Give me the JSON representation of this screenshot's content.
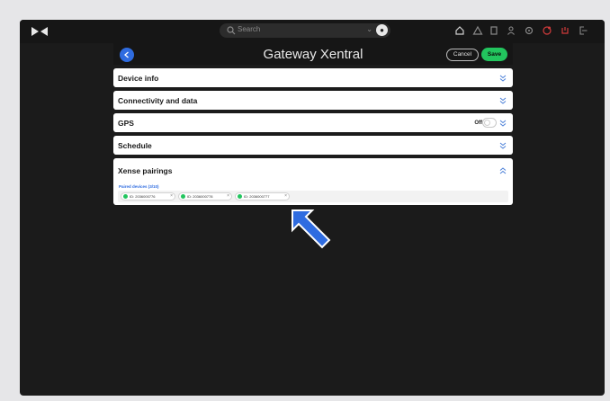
{
  "topbar": {
    "search_placeholder": "Search",
    "icons": [
      "home-icon",
      "alert-icon",
      "building-icon",
      "user-icon",
      "settings-icon",
      "notifications-icon",
      "power-icon",
      "logout-icon"
    ]
  },
  "header": {
    "title": "Gateway Xentral",
    "cancel_label": "Cancel",
    "save_label": "Save"
  },
  "sections": [
    {
      "title": "Device info"
    },
    {
      "title": "Connectivity and data"
    },
    {
      "title": "GPS",
      "toggle_label": "Off",
      "toggle_on": false
    },
    {
      "title": "Schedule"
    },
    {
      "title": "Xense pairings",
      "expanded": true
    }
  ],
  "pairings": {
    "label": "Paired devices (3/10)",
    "devices": [
      {
        "label": "ID: 2036000776"
      },
      {
        "label": "ID: 2036000778"
      },
      {
        "label": "ID: 2036000777"
      }
    ]
  },
  "colors": {
    "accent_blue": "#2f6ce0",
    "save_green": "#22c55e",
    "chevron_blue": "#4a7fd8"
  }
}
